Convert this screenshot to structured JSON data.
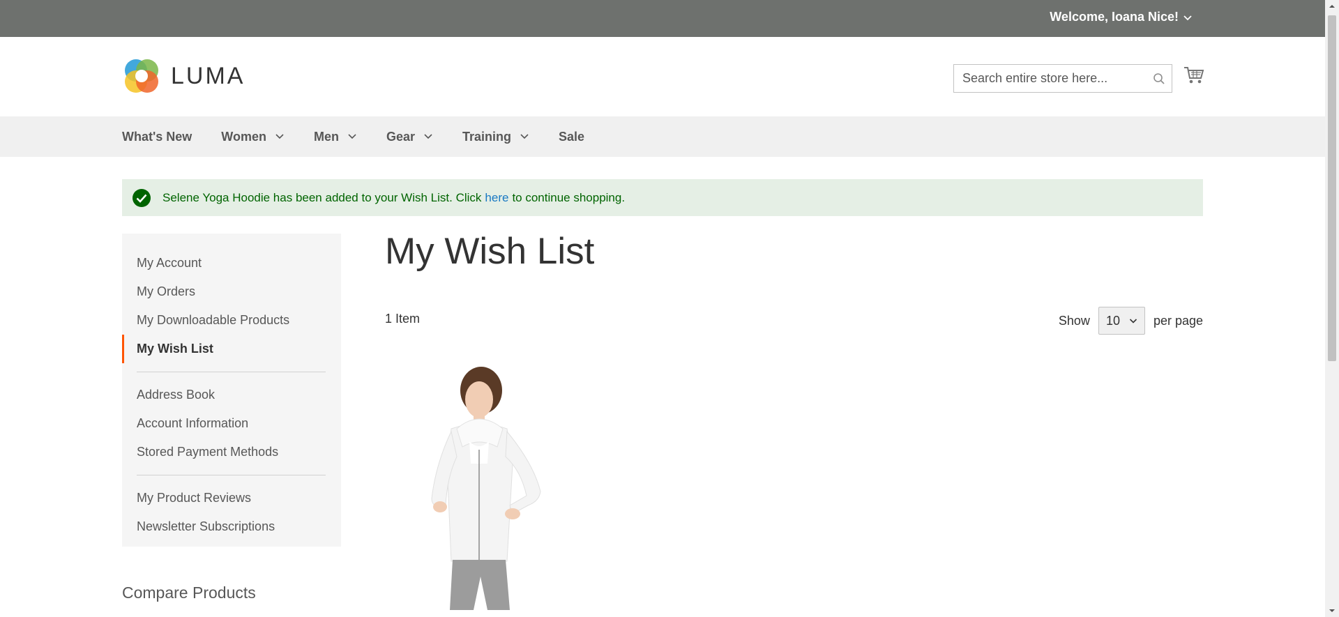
{
  "header": {
    "welcome": "Welcome, Ioana Nice!",
    "logo_text": "LUMA",
    "search_placeholder": "Search entire store here..."
  },
  "nav": {
    "items": [
      {
        "label": "What's New",
        "has_dropdown": false
      },
      {
        "label": "Women",
        "has_dropdown": true
      },
      {
        "label": "Men",
        "has_dropdown": true
      },
      {
        "label": "Gear",
        "has_dropdown": true
      },
      {
        "label": "Training",
        "has_dropdown": true
      },
      {
        "label": "Sale",
        "has_dropdown": false
      }
    ]
  },
  "message": {
    "text_before": "Selene Yoga Hoodie has been added to your Wish List. Click",
    "link": "here",
    "text_after": "to continue shopping."
  },
  "sidebar": {
    "items": [
      "My Account",
      "My Orders",
      "My Downloadable Products",
      "My Wish List",
      "Address Book",
      "Account Information",
      "Stored Payment Methods",
      "My Product Reviews",
      "Newsletter Subscriptions"
    ],
    "active": "My Wish List",
    "compare_title": "Compare Products"
  },
  "main": {
    "title": "My Wish List",
    "item_count": "1 Item",
    "show_label": "Show",
    "per_page_value": "10",
    "per_page_label": "per page"
  },
  "colors": {
    "topbar": "#6e716e",
    "nav_bg": "#f0f0f0",
    "accent": "#ff5501",
    "link": "#1979c3",
    "success_bg": "#e5efe5",
    "success_text": "#006400"
  }
}
